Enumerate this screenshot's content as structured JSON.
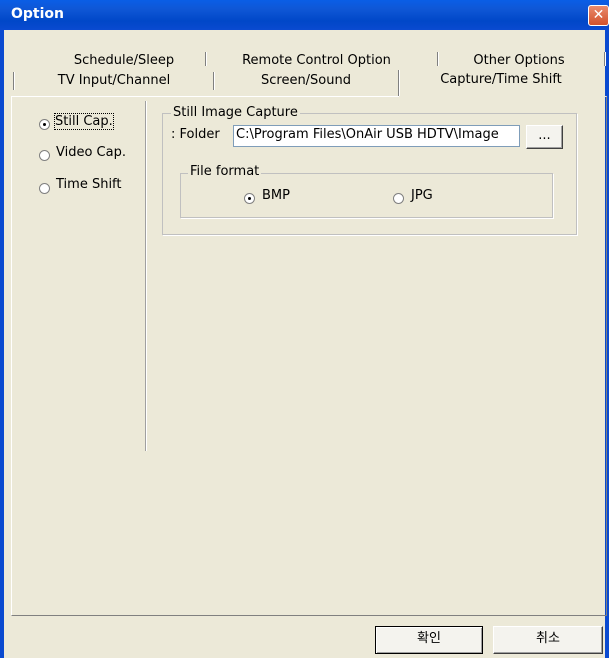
{
  "window": {
    "title": "Option",
    "close_glyph": "✕"
  },
  "tabs": {
    "row1": [
      "Schedule/Sleep",
      "Remote Control Option",
      "Other Options"
    ],
    "row2": [
      "TV Input/Channel",
      "Screen/Sound",
      "Capture/Time Shift"
    ],
    "active": "Capture/Time Shift"
  },
  "modes": {
    "items": [
      {
        "label": "Still Cap.",
        "selected": true
      },
      {
        "label": "Video Cap.",
        "selected": false
      },
      {
        "label": "Time Shift",
        "selected": false
      }
    ]
  },
  "still_capture": {
    "group_title": "Still Image Capture",
    "folder_label": ": Folder",
    "folder_value": "C:\\Program Files\\OnAir USB HDTV\\Image",
    "browse_label": "...",
    "format_group_title": "File format",
    "formats": [
      {
        "label": "BMP",
        "selected": true
      },
      {
        "label": "JPG",
        "selected": false
      }
    ]
  },
  "footer": {
    "ok_label": "확인",
    "cancel_label": "취소"
  },
  "colors": {
    "titlebar": "#0a4ad0",
    "dialog_bg": "#ece9d8",
    "close": "#d2522c"
  }
}
